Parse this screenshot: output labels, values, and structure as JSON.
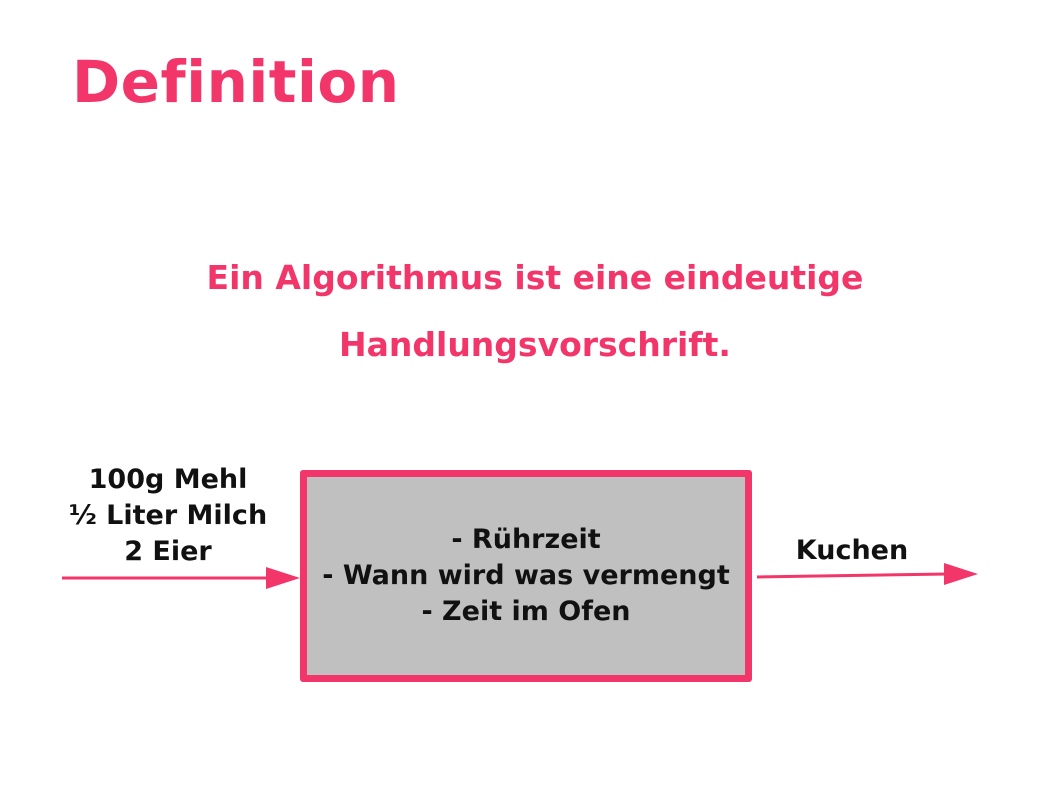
{
  "slide": {
    "title": "Definition",
    "definition": {
      "lines": [
        "Ein Algorithmus ist eine eindeutige",
        "Handlungsvorschrift."
      ]
    }
  },
  "diagram": {
    "inputs": [
      "100g Mehl",
      "½ Liter Milch",
      "2 Eier"
    ],
    "process_steps": [
      "- Rührzeit",
      "- Wann wird was vermengt",
      "- Zeit im Ofen"
    ],
    "output": "Kuchen"
  },
  "colors": {
    "accent": "#f3366a",
    "box_fill": "#c0c0c0",
    "text": "#111111",
    "background": "#ffffff"
  }
}
